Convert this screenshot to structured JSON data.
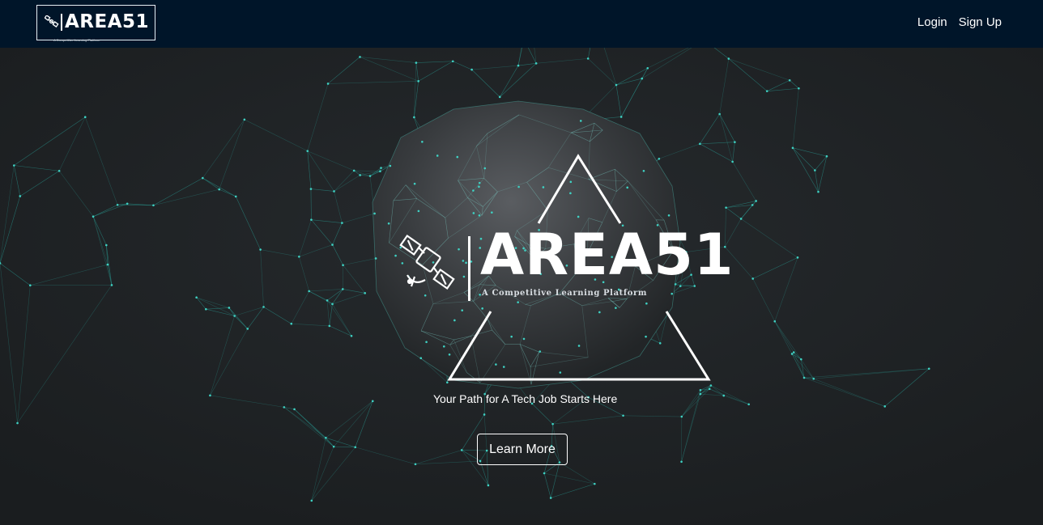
{
  "navbar": {
    "logo_text": "AREA51",
    "logo_tagline": "A Competitive Learning Platform",
    "links": [
      {
        "label": "Login"
      },
      {
        "label": "Sign Up"
      }
    ]
  },
  "hero": {
    "logo_text": "AREA51",
    "logo_tagline": "A Competitive Learning Platform",
    "tagline": "Your Path for A Tech Job Starts Here",
    "cta_label": "Learn More"
  },
  "colors": {
    "navbar_bg": "#001529",
    "page_bg": "#1c1f21",
    "network_accent": "#2ba39a"
  },
  "icons": [
    "satellite-icon"
  ]
}
